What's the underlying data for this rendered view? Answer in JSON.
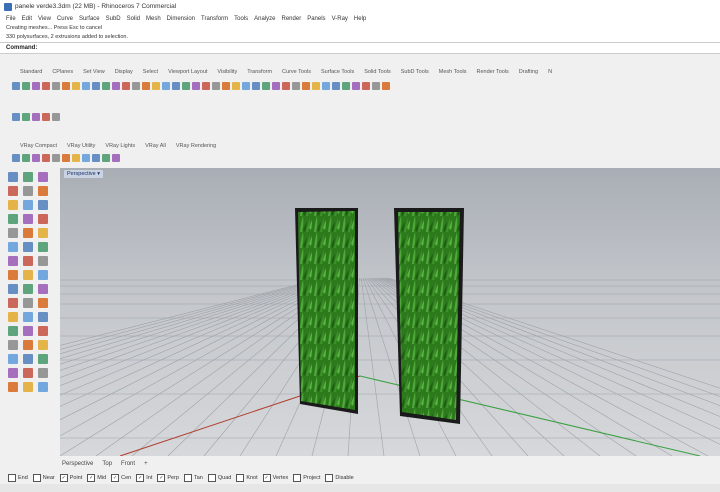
{
  "window": {
    "title": "panele verde3.3dm (22 MB) - Rhinoceros 7 Commercial"
  },
  "menu": [
    "File",
    "Edit",
    "View",
    "Curve",
    "Surface",
    "SubD",
    "Solid",
    "Mesh",
    "Dimension",
    "Transform",
    "Tools",
    "Analyze",
    "Render",
    "Panels",
    "V-Ray",
    "Help"
  ],
  "history": [
    "Creating meshes... Press Esc to cancel",
    "330 polysurfaces, 2 extrusions added to selection."
  ],
  "command": {
    "label": "Command:",
    "value": ""
  },
  "toolbar_tabs": [
    "Standard",
    "CPlanes",
    "Set View",
    "Display",
    "Select",
    "Viewport Layout",
    "Visibility",
    "Transform",
    "Curve Tools",
    "Surface Tools",
    "Solid Tools",
    "SubD Tools",
    "Mesh Tools",
    "Render Tools",
    "Drafting",
    "N"
  ],
  "vray_tabs": [
    "VRay Compact",
    "VRay Utility",
    "VRay Lights",
    "VRay All",
    "VRay Rendering"
  ],
  "viewport": {
    "name": "Perspective",
    "menu_arrow": "▾"
  },
  "viewport_tabs": [
    "Perspective",
    "Top",
    "Front",
    "+"
  ],
  "osnaps": [
    {
      "label": "End",
      "checked": false
    },
    {
      "label": "Near",
      "checked": false
    },
    {
      "label": "Point",
      "checked": true
    },
    {
      "label": "Mid",
      "checked": true
    },
    {
      "label": "Cen",
      "checked": true
    },
    {
      "label": "Int",
      "checked": true
    },
    {
      "label": "Perp",
      "checked": true
    },
    {
      "label": "Tan",
      "checked": false
    },
    {
      "label": "Quad",
      "checked": false
    },
    {
      "label": "Knot",
      "checked": false
    },
    {
      "label": "Vertex",
      "checked": true
    },
    {
      "label": "Project",
      "checked": false
    },
    {
      "label": "Disable",
      "checked": false
    }
  ],
  "colors": {
    "panel_green": "#2f7a1e",
    "grid_red": "#b04030",
    "grid_green": "#3aa040"
  }
}
